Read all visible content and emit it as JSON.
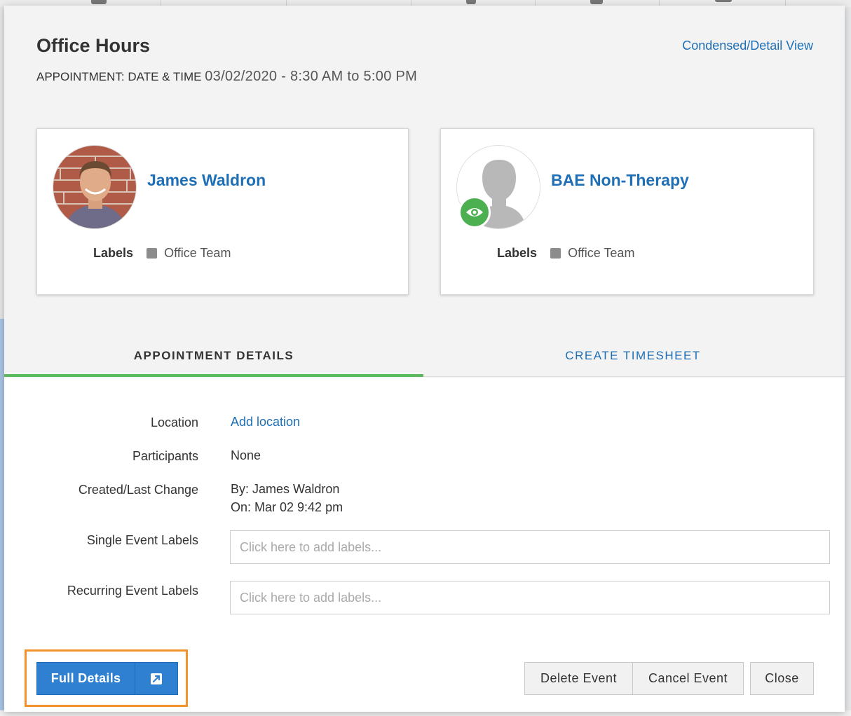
{
  "modal": {
    "title": "Office Hours",
    "view_toggle": "Condensed/Detail View",
    "appointment_label": "APPOINTMENT: DATE & TIME",
    "appointment_value": "03/02/2020 - 8:30 AM to 5:00 PM"
  },
  "cards": [
    {
      "name": "James Waldron",
      "labels_key": "Labels",
      "label_value": "Office Team",
      "label_color": "#8c8c8c"
    },
    {
      "name": "BAE Non-Therapy",
      "labels_key": "Labels",
      "label_value": "Office Team",
      "label_color": "#8c8c8c"
    }
  ],
  "tabs": [
    {
      "label": "Appointment Details",
      "active": true
    },
    {
      "label": "Create Timesheet",
      "active": false
    }
  ],
  "details": {
    "location_key": "Location",
    "location_value": "Add location",
    "participants_key": "Participants",
    "participants_value": "None",
    "created_key": "Created/Last Change",
    "created_by": "By: James Waldron",
    "created_on": "On: Mar 02 9:42 pm",
    "single_labels_key": "Single Event Labels",
    "single_labels_placeholder": "Click here to add labels...",
    "recurring_labels_key": "Recurring Event Labels",
    "recurring_labels_placeholder": "Click here to add labels..."
  },
  "footer": {
    "full_details": "Full Details",
    "full_details_icon": "external-link-icon",
    "delete": "Delete Event",
    "cancel": "Cancel Event",
    "close": "Close"
  },
  "colors": {
    "link": "#1e6fb5",
    "active_tab": "#5cb85c",
    "primary_button": "#2f80d0",
    "highlight": "#f0932b",
    "eye_badge": "#4caf50"
  }
}
